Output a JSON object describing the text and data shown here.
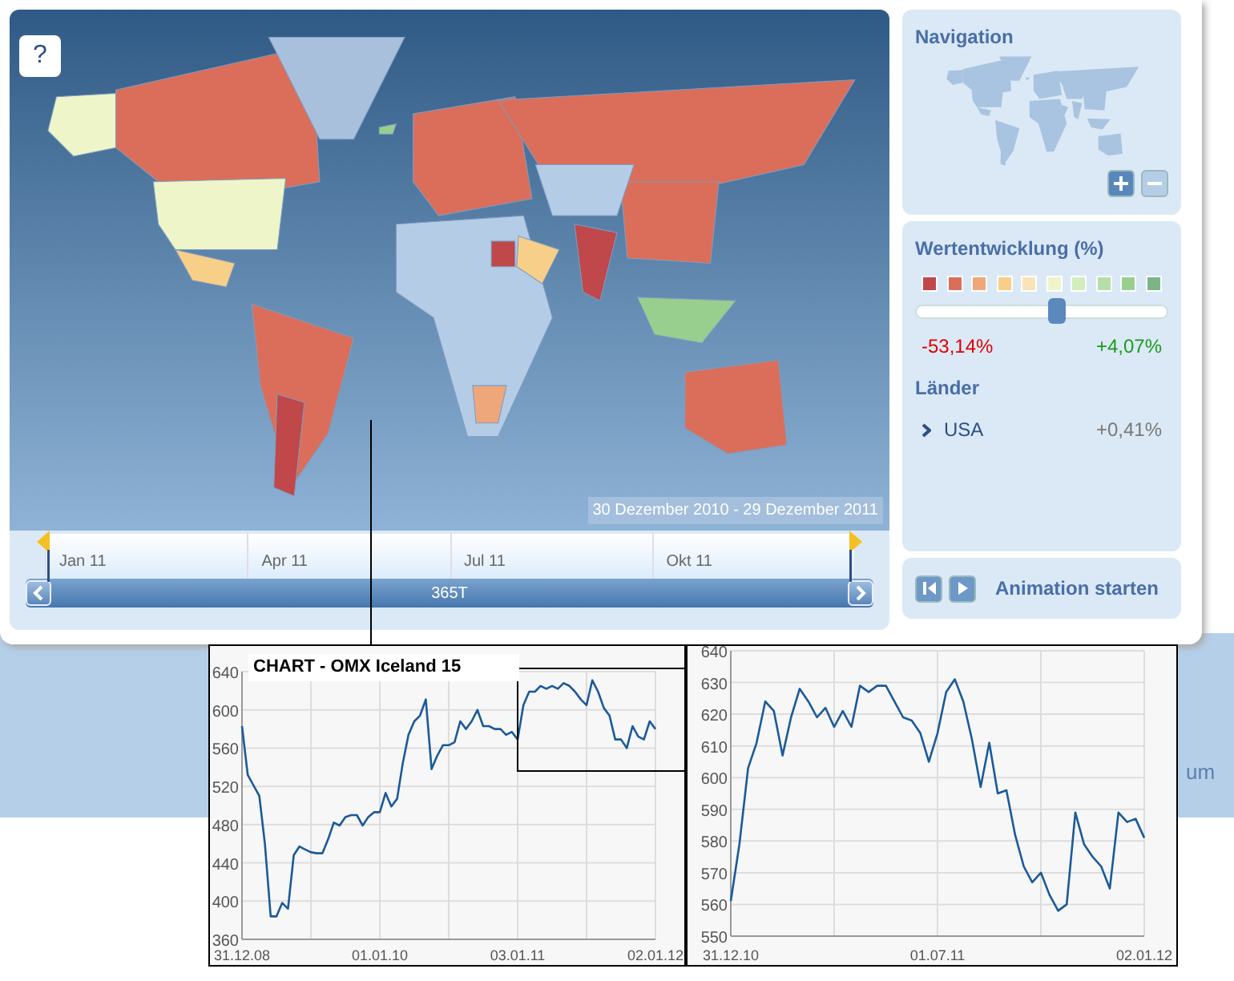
{
  "map": {
    "help": "?",
    "date_range": "30 Dezember 2010 - 29 Dezember 2011"
  },
  "timeline": {
    "months": [
      "Jan 11",
      "Apr 11",
      "Jul 11",
      "Okt 11"
    ],
    "range_label": "365T"
  },
  "navigation": {
    "title": "Navigation"
  },
  "performance": {
    "title": "Wertentwicklung (%)",
    "legend": [
      {
        "color": "#c0474a"
      },
      {
        "color": "#db6e5a"
      },
      {
        "color": "#eea77b"
      },
      {
        "color": "#f8cf88"
      },
      {
        "color": "#fbe3b8"
      },
      {
        "color": "#eef5c8"
      },
      {
        "color": "#d3edbd"
      },
      {
        "color": "#b5deaa"
      },
      {
        "color": "#98cf8f"
      },
      {
        "color": "#7db487"
      }
    ],
    "level": 0.56,
    "min": "-53,14%",
    "max": "+4,07%"
  },
  "countries": {
    "title": "Länder",
    "items": [
      {
        "name": "USA",
        "change": "+0,41%"
      }
    ]
  },
  "animation": {
    "label": "Animation starten"
  },
  "background_text": "um",
  "charts": [
    {
      "title": "CHART - OMX Iceland 15",
      "chart_data": {
        "type": "line",
        "grid": true,
        "categories": [
          "31.12.08",
          null,
          null,
          null,
          null,
          null,
          null,
          null,
          null,
          null,
          null,
          null,
          null,
          null,
          null,
          null,
          null,
          null,
          null,
          null,
          null,
          null,
          null,
          null,
          "01.01.10",
          null,
          null,
          null,
          null,
          null,
          null,
          null,
          null,
          null,
          null,
          null,
          null,
          null,
          null,
          null,
          null,
          null,
          null,
          null,
          null,
          null,
          null,
          null,
          "03.01.11",
          null,
          null,
          null,
          null,
          null,
          null,
          null,
          null,
          null,
          null,
          null,
          null,
          null,
          null,
          null,
          null,
          null,
          null,
          null,
          null,
          null,
          null,
          null,
          "02.01.12"
        ],
        "series": [
          {
            "color": "#1a5a9a",
            "values": [
              583,
              532,
              521,
              510,
              460,
              384,
              384,
              398,
              392,
              448,
              457,
              454,
              451,
              450,
              450,
              465,
              482,
              479,
              488,
              490,
              490,
              479,
              488,
              493,
              493,
              513,
              499,
              507,
              544,
              574,
              588,
              594,
              611,
              538,
              552,
              563,
              563,
              566,
              588,
              580,
              588,
              600,
              583,
              583,
              580,
              580,
              574,
              577,
              569,
              605,
              619,
              619,
              625,
              622,
              625,
              622,
              628,
              625,
              619,
              611,
              605,
              631,
              619,
              602,
              594,
              569,
              569,
              560,
              583,
              572,
              569,
              588,
              580
            ]
          }
        ],
        "ylim": [
          360,
          640
        ],
        "yticks": [
          360,
          400,
          440,
          480,
          520,
          560,
          600,
          640
        ]
      }
    },
    {
      "chart_data": {
        "type": "line",
        "grid": true,
        "categories": [
          "31.12.10",
          null,
          null,
          null,
          null,
          null,
          null,
          null,
          null,
          null,
          null,
          null,
          null,
          null,
          null,
          null,
          null,
          null,
          null,
          null,
          null,
          null,
          null,
          null,
          "01.07.11",
          null,
          null,
          null,
          null,
          null,
          null,
          null,
          null,
          null,
          null,
          null,
          null,
          null,
          null,
          null,
          null,
          null,
          null,
          null,
          null,
          null,
          null,
          null,
          "02.01.12"
        ],
        "series": [
          {
            "color": "#1a5a9a",
            "values": [
              561,
              579,
              603,
              611,
              624,
              621,
              607,
              619,
              628,
              624,
              619,
              622,
              616,
              621,
              616,
              629,
              627,
              629,
              629,
              624,
              619,
              618,
              614,
              605,
              614,
              627,
              631,
              624,
              612,
              597,
              611,
              595,
              596,
              582,
              572,
              567,
              570,
              563,
              558,
              560,
              589,
              579,
              575,
              572,
              565,
              589,
              586,
              587,
              581
            ]
          }
        ],
        "ylim": [
          550,
          640
        ],
        "yticks": [
          550,
          560,
          570,
          580,
          590,
          600,
          610,
          620,
          630,
          640
        ]
      }
    }
  ]
}
